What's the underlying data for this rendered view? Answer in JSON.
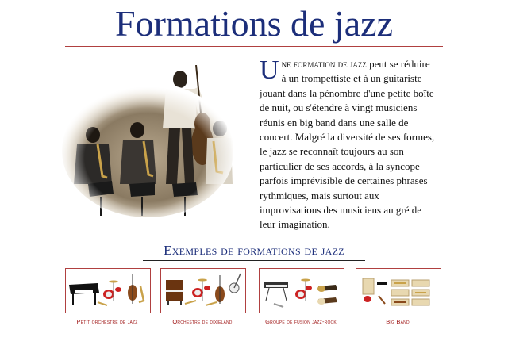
{
  "page": {
    "title": "Formations de jazz"
  },
  "article": {
    "dropcap": "U",
    "lead_smallcaps": "ne formation de jazz",
    "text": " peut se réduire à un trompettiste et à un guitariste jouant dans la pénombre d'une petite boîte de nuit, ou s'étendre à vingt musiciens réunis en big band dans une salle de concert. Malgré la diversité de ses formes, le jazz se reconnaît toujours au son particulier de ses accords, à la syncope parfois imprévisible de certaines phrases rythmiques, mais surtout aux improvisations des musiciens au gré de leur imagination."
  },
  "examples": {
    "heading": "Exemples de formations de jazz",
    "items": [
      {
        "label": "Petit orchestre de jazz",
        "icon": "piano-drums-bass-sax-icon"
      },
      {
        "label": "Orchestre de dixieland",
        "icon": "upright-piano-drums-banjo-icon"
      },
      {
        "label": "Groupe de fusion jazz-rock",
        "icon": "synth-drums-guitars-icon"
      },
      {
        "label": "Big Band",
        "icon": "big-band-sections-icon"
      }
    ]
  },
  "colors": {
    "title_blue": "#1c2e7a",
    "rule_red": "#b04040",
    "label_red": "#a01818"
  }
}
